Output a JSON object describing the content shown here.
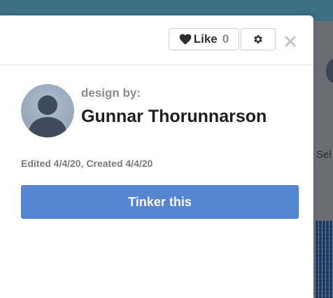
{
  "like": {
    "label": "Like",
    "count": "0",
    "icon": "heart-icon"
  },
  "settings": {
    "icon": "gear-icon"
  },
  "close": {
    "icon": "close-icon"
  },
  "design": {
    "by_label": "design by:",
    "author_name": "Gunnar Thorunnarson",
    "dates": "Edited 4/4/20, Created 4/4/20"
  },
  "actions": {
    "tinker_label": "Tinker this"
  },
  "background": {
    "partial_text": "Sel"
  },
  "colors": {
    "accent": "#5586d1",
    "header_bar": "#3d6f85",
    "count": "#8d8d8d"
  }
}
